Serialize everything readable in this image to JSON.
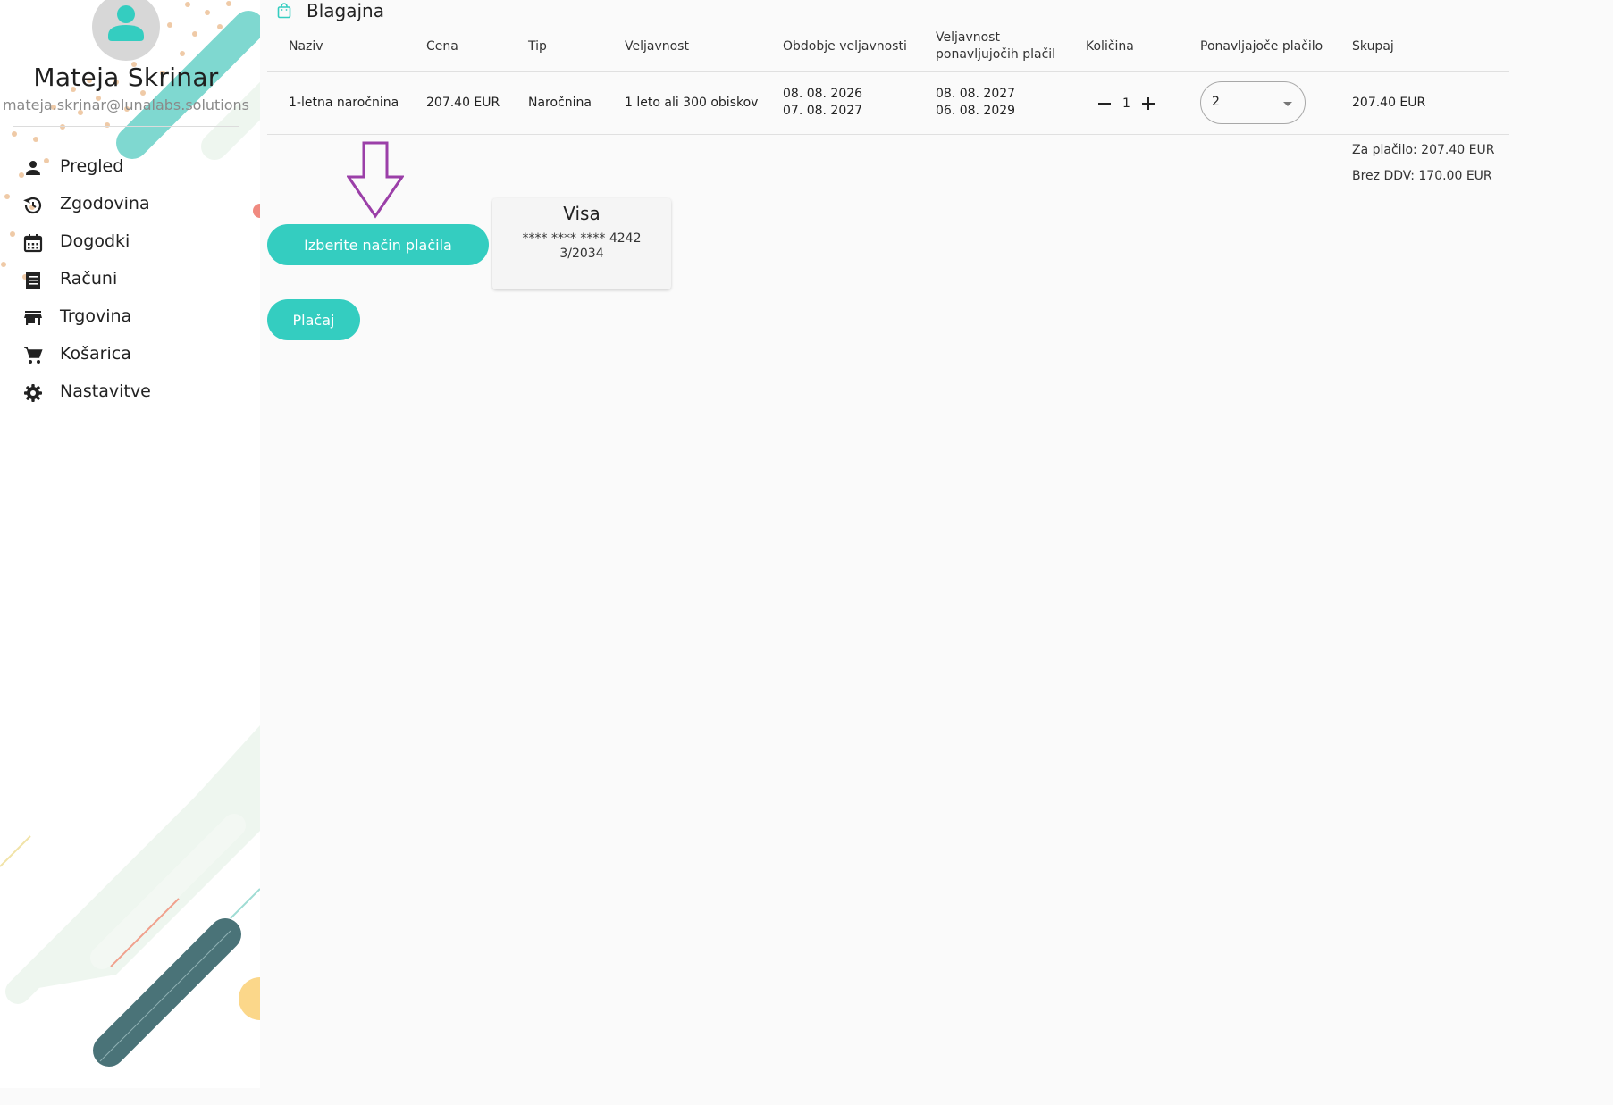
{
  "sidebar": {
    "user_name": "Mateja Skrinar",
    "user_email": "mateja.skrinar@lunalabs.solutions",
    "items": [
      {
        "label": "Pregled",
        "icon": "person-icon"
      },
      {
        "label": "Zgodovina",
        "icon": "history-icon"
      },
      {
        "label": "Dogodki",
        "icon": "calendar-icon"
      },
      {
        "label": "Računi",
        "icon": "receipt-icon"
      },
      {
        "label": "Trgovina",
        "icon": "store-icon"
      },
      {
        "label": "Košarica",
        "icon": "cart-icon"
      },
      {
        "label": "Nastavitve",
        "icon": "gear-icon"
      }
    ]
  },
  "page": {
    "title": "Blagajna",
    "title_icon": "shopping-bag-icon"
  },
  "table": {
    "columns": [
      "Naziv",
      "Cena",
      "Tip",
      "Veljavnost",
      "Obdobje veljavnosti",
      "Veljavnost ponavljočih plačil",
      "Količina",
      "Ponavljajoče plačilo",
      "Skupaj"
    ],
    "col_validity_line1": "Veljavnost",
    "col_validity_line2": "ponavljujočih plačil",
    "row": {
      "name": "1-letna naročnina",
      "price": "207.40 EUR",
      "type": "Naročnina",
      "validity": "1 leto ali 300 obiskov",
      "period_start": "08. 08. 2026",
      "period_end": "07. 08. 2027",
      "recurring_start": "08. 08. 2027",
      "recurring_end": "06. 08. 2029",
      "quantity": "1",
      "recurring_payment": "2",
      "total": "207.40 EUR"
    }
  },
  "totals": {
    "to_pay": "Za plačilo: 207.40 EUR",
    "without_vat": "Brez DDV: 170.00 EUR"
  },
  "payment": {
    "choose_label": "Izberite način plačila",
    "pay_label": "Plačaj",
    "card_brand": "Visa",
    "card_number": "**** **** **** 4242",
    "card_expiry": "3/2034"
  },
  "colors": {
    "accent": "#34cdc0",
    "annotation_arrow": "#9b3fa8",
    "sidebar_dark_stripe": "#4a7378"
  }
}
